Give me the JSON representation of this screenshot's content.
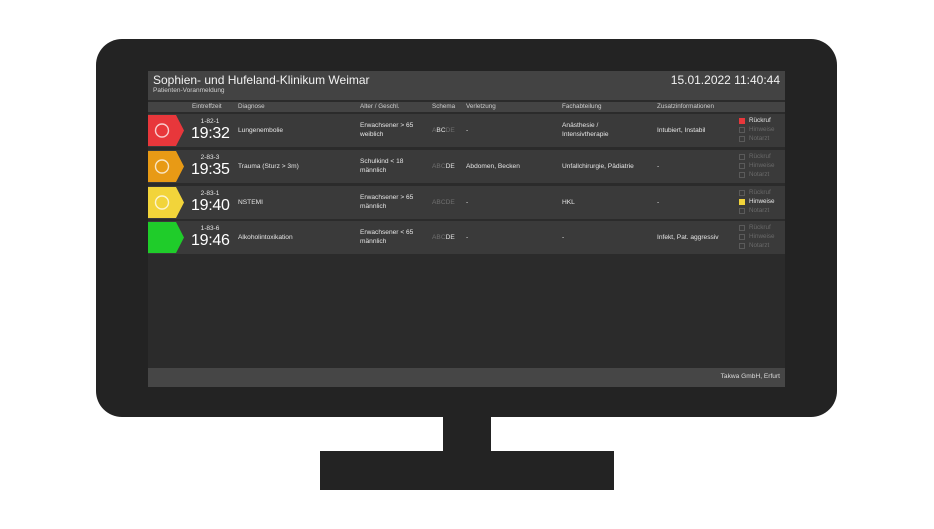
{
  "header": {
    "clinic_name": "Sophien- und Hufeland-Klinikum Weimar",
    "subtitle": "Patienten-Voranmeldung",
    "datetime": "15.01.2022 11:40:44"
  },
  "columns": [
    "Eintreffzeit",
    "Diagnose",
    "Alter / Geschl.",
    "Schema",
    "Verletzung",
    "Fachabteilung",
    "Zusatzinformationen"
  ],
  "schema_letters": [
    "A",
    "B",
    "C",
    "D",
    "E"
  ],
  "flag_labels": [
    "Rückruf",
    "Hinweise",
    "Notarzt"
  ],
  "patients": [
    {
      "triage_color": "#e8373b",
      "circle": true,
      "id": "1-82-1",
      "time": "19:32",
      "diagnosis": "Lungenembolie",
      "age_line1": "Erwachsener > 65",
      "age_line2": "weiblich",
      "schema_active": [
        false,
        true,
        true,
        false,
        false
      ],
      "injury": "-",
      "dept_line1": "Anästhesie /",
      "dept_line2": "Intensivtherapie",
      "extra": "Intubiert, Instabil",
      "flags": [
        true,
        false,
        false
      ],
      "flag_color": "#e8373b"
    },
    {
      "triage_color": "#e89a15",
      "circle": true,
      "id": "2-83-3",
      "time": "19:35",
      "diagnosis": "Trauma (Sturz > 3m)",
      "age_line1": "Schulkind < 18",
      "age_line2": "männlich",
      "schema_active": [
        false,
        false,
        false,
        true,
        true
      ],
      "injury": "Abdomen, Becken",
      "dept_line1": "Unfallchirurgie, Pädiatrie",
      "dept_line2": "",
      "extra": "-",
      "flags": [
        false,
        false,
        false
      ],
      "flag_color": "#e8373b"
    },
    {
      "triage_color": "#f2d43a",
      "circle": true,
      "id": "2-83-1",
      "time": "19:40",
      "diagnosis": "NSTEMI",
      "age_line1": "Erwachsener > 65",
      "age_line2": "männlich",
      "schema_active": [
        false,
        false,
        false,
        false,
        false
      ],
      "injury": "-",
      "dept_line1": "HKL",
      "dept_line2": "",
      "extra": "-",
      "flags": [
        false,
        true,
        false
      ],
      "flag_color": "#f2d43a"
    },
    {
      "triage_color": "#1fcc2a",
      "circle": false,
      "id": "1-83-6",
      "time": "19:46",
      "diagnosis": "Alkoholintoxikation",
      "age_line1": "Erwachsener < 65",
      "age_line2": "männlich",
      "schema_active": [
        false,
        false,
        false,
        true,
        true
      ],
      "injury": "-",
      "dept_line1": "-",
      "dept_line2": "",
      "extra": "Infekt, Pat. aggressiv",
      "flags": [
        false,
        false,
        false
      ],
      "flag_color": "#e8373b"
    }
  ],
  "footer": {
    "company": "Takwa GmbH, Erfurt"
  }
}
